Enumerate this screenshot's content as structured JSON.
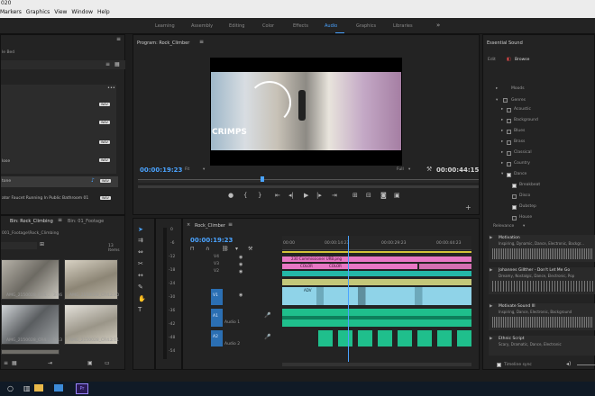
{
  "title_fragment": "020",
  "menu": [
    "Markers",
    "Graphics",
    "View",
    "Window",
    "Help"
  ],
  "workspaces": [
    "Learning",
    "Assembly",
    "Editing",
    "Color",
    "Effects",
    "Audio",
    "Graphics",
    "Libraries"
  ],
  "active_workspace": "Audio",
  "project": {
    "search_partial": "le Bed",
    "badges": [
      "WAV",
      "WAV",
      "WAV",
      "WAV",
      "WAV",
      "WAV"
    ],
    "file_item_1": "lose",
    "file_item_2": "tone",
    "file_item_3": "ator Faucet Running In Public Bathroom 01",
    "tab_bin": "Bin: Rock_Climbing",
    "tab_bin2": "Bin: 01_Footage",
    "path": "001_Footage\\Rock_Climbing",
    "items_count": "13 Items",
    "thumbs": [
      {
        "label": "AMG_2150028_CR4...",
        "dur": "3:06"
      },
      {
        "label": "AMG_2150028_CR4...",
        "dur": "2:20"
      },
      {
        "label": "AMG_2150028_CR4...",
        "dur": "9:13"
      },
      {
        "label": "AMG_2150028_CR4...",
        "dur": "2:11"
      },
      {
        "label": "AMG_2150028_CR4...",
        "dur": "9:12"
      }
    ]
  },
  "program": {
    "title": "Program: Rock_Climber",
    "overlay": "CRIMPS",
    "timecode": "00:00:19:23",
    "zoom": "Fit",
    "quality": "Full",
    "duration": "00:00:44:15"
  },
  "timeline": {
    "title": "Rock_Climber",
    "timecode": "00:00:19:23",
    "ruler": [
      "00:00",
      "00:00:14:23",
      "00:00:29:23",
      "00:00:44:23"
    ],
    "db_marks": [
      "0",
      "-6",
      "-12",
      "-18",
      "-24",
      "-30",
      "-36",
      "-42",
      "-48",
      "-54"
    ],
    "tracks": [
      "V4",
      "V3",
      "V2",
      "V1",
      "A1",
      "A2"
    ],
    "track_labels": [
      "Audio 1",
      "Audio 2"
    ],
    "clip_labels": [
      "230 Commissioner URB.png",
      "COLOR",
      "COLOR",
      "ADV"
    ]
  },
  "essential_sound": {
    "title": "Essential Sound",
    "tabs": [
      "Edit",
      "Browse"
    ],
    "moods": "Moods",
    "genres_header": "Genres",
    "genres": [
      {
        "name": "Acoustic",
        "checked": false
      },
      {
        "name": "Background",
        "checked": false
      },
      {
        "name": "Blues",
        "checked": false
      },
      {
        "name": "Brass",
        "checked": false
      },
      {
        "name": "Classical",
        "checked": false
      },
      {
        "name": "Country",
        "checked": false
      },
      {
        "name": "Dance",
        "checked": true
      }
    ],
    "subgenres": [
      {
        "name": "Breakbeat",
        "checked": true
      },
      {
        "name": "Disco",
        "checked": false
      },
      {
        "name": "Dubstep",
        "checked": true
      },
      {
        "name": "House",
        "checked": false
      }
    ],
    "sort": "Relevance",
    "results": [
      {
        "title": "Motivation",
        "desc": "Inspiring, Dynamic, Dance, Electronic, Backgr..."
      },
      {
        "title": "Johannes Gillther - Don't Let Me Go",
        "desc": "Dreamy, Nostalgic, Dance, Electronic, Pop"
      },
      {
        "title": "Motivate Sound III",
        "desc": "Inspiring, Dance, Electronic, Background"
      },
      {
        "title": "Ethnic Script",
        "desc": "Scary, Dramatic, Dance, Electronic"
      }
    ],
    "timeline_sync": "Timeline sync"
  },
  "colors": {
    "accent": "#4aa3ff",
    "pink_clip": "#e777c4",
    "teal_clip": "#24b8a8",
    "green_audio": "#1fbf8c",
    "blue_video": "#8fd3e8"
  }
}
